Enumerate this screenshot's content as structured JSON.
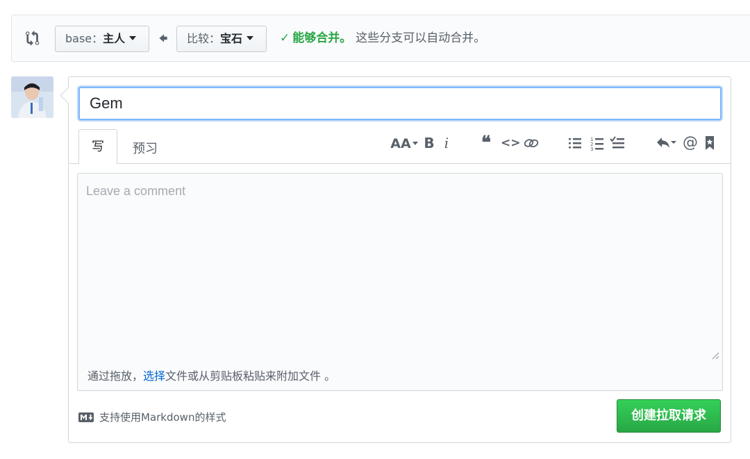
{
  "range": {
    "base_prefix": "base：",
    "base_value": "主人",
    "head_prefix": "比较：",
    "head_value": "宝石",
    "merge_ok": "能够合并。",
    "merge_desc": "这些分支可以自动合并。",
    "check_glyph": "✓"
  },
  "pr_form": {
    "title_value": "Gem",
    "tabs": [
      "写",
      "预习"
    ],
    "comment_placeholder": "Leave a comment",
    "drag_hint_before": "通过拖放，",
    "drag_hint_link": "选择",
    "drag_hint_after": "文件或从剪贴板粘贴来附加文件 。",
    "markdown_note": "支持使用Markdown的样式",
    "submit_label": "创建拉取请求"
  },
  "toolbar": {
    "heading_glyph": "AA",
    "bold_glyph": "B",
    "italic_glyph": "i",
    "quote_glyph": "❝",
    "code_glyph": "<>",
    "mention_glyph": "@",
    "icons": [
      "text-size-icon",
      "bold-icon",
      "italic-icon",
      "quote-icon",
      "code-icon",
      "link-icon",
      "unordered-list-icon",
      "ordered-list-icon",
      "task-list-icon",
      "reply-icon",
      "mention-icon",
      "bookmark-icon"
    ]
  },
  "colors": {
    "accent_green": "#28a745",
    "link_blue": "#0366d6",
    "focus_blue": "#79b8ff"
  }
}
